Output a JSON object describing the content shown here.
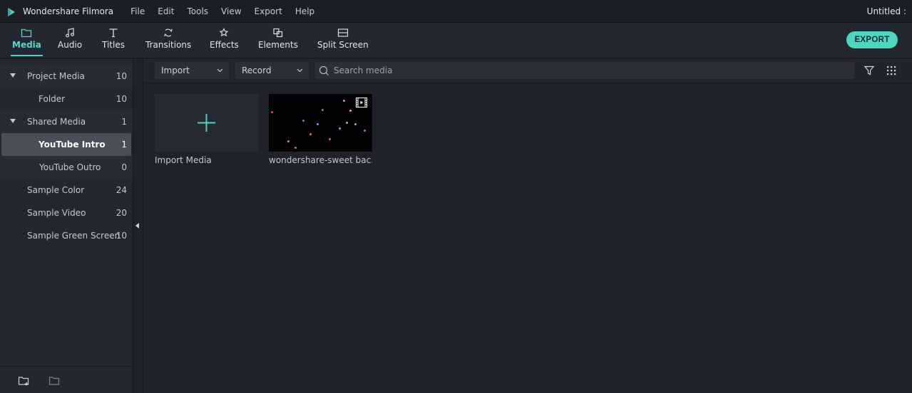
{
  "app": {
    "name": "Wondershare Filmora",
    "document_title": "Untitled :"
  },
  "menu": [
    "File",
    "Edit",
    "Tools",
    "View",
    "Export",
    "Help"
  ],
  "toolbar": {
    "tabs": [
      {
        "label": "Media",
        "icon": "folder-icon",
        "active": true
      },
      {
        "label": "Audio",
        "icon": "music-note-icon",
        "active": false
      },
      {
        "label": "Titles",
        "icon": "text-t-icon",
        "active": false
      },
      {
        "label": "Transitions",
        "icon": "transition-icon",
        "active": false
      },
      {
        "label": "Effects",
        "icon": "effects-star-icon",
        "active": false
      },
      {
        "label": "Elements",
        "icon": "elements-icon",
        "active": false
      },
      {
        "label": "Split Screen",
        "icon": "split-screen-icon",
        "active": false
      }
    ],
    "export_label": "EXPORT"
  },
  "sidebar": {
    "items": [
      {
        "label": "Project Media",
        "count": "10",
        "expanded": true
      },
      {
        "label": "Folder",
        "count": "10"
      },
      {
        "label": "Shared Media",
        "count": "1",
        "expanded": true
      },
      {
        "label": "YouTube Intro",
        "count": "1",
        "selected": true
      },
      {
        "label": "YouTube Outro",
        "count": "0"
      },
      {
        "label": "Sample Color",
        "count": "24"
      },
      {
        "label": "Sample Video",
        "count": "20"
      },
      {
        "label": "Sample Green Screen",
        "count": "10"
      }
    ],
    "footer_icons": [
      "new-folder-icon",
      "folder-outline-icon"
    ]
  },
  "filter_bar": {
    "import_label": "Import",
    "record_label": "Record",
    "search_placeholder": "Search media",
    "icons": [
      "filter-icon",
      "grid-view-icon"
    ]
  },
  "media": [
    {
      "caption": "Import Media",
      "type": "import"
    },
    {
      "caption": "wondershare-sweet bac...",
      "type": "video"
    }
  ],
  "colors": {
    "accent": "#4fd6c0",
    "background": "#1e222b",
    "panel": "#232730",
    "selected": "#4a4e58"
  }
}
